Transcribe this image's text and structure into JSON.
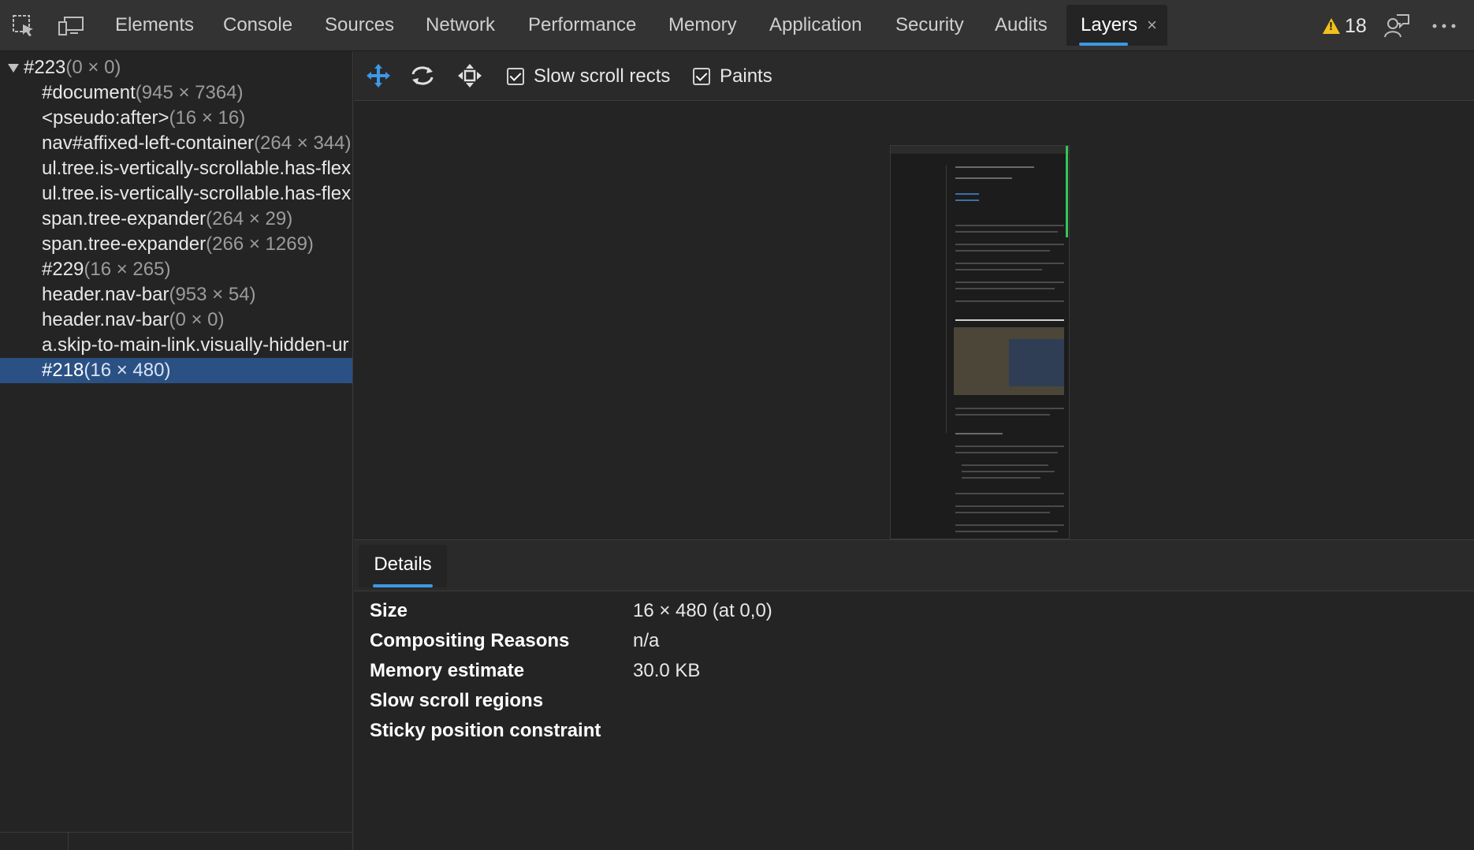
{
  "colors": {
    "accent": "#3c99e6",
    "selected_row": "#2b5184",
    "warning": "#f1c21b"
  },
  "topbar": {
    "tabs": [
      {
        "label": "Elements"
      },
      {
        "label": "Console"
      },
      {
        "label": "Sources"
      },
      {
        "label": "Network"
      },
      {
        "label": "Performance"
      },
      {
        "label": "Memory"
      },
      {
        "label": "Application"
      },
      {
        "label": "Security"
      },
      {
        "label": "Audits"
      },
      {
        "label": "Layers",
        "active": true
      }
    ],
    "close_glyph": "×",
    "warning_count": "18",
    "icons": [
      "inspect-element-icon",
      "device-toolbar-icon",
      "warning-icon",
      "feedback-icon",
      "more-menu-icon"
    ]
  },
  "tree": {
    "root": {
      "name": "#223",
      "size": "(0 × 0)"
    },
    "items": [
      {
        "name": "#document",
        "size": "(945 × 7364)"
      },
      {
        "name": "<pseudo:after>",
        "size": "(16 × 16)"
      },
      {
        "name": "nav#affixed-left-container",
        "size": "(264 × 344)"
      },
      {
        "name": "ul.tree.is-vertically-scrollable.has-flex",
        "size": ""
      },
      {
        "name": "ul.tree.is-vertically-scrollable.has-flex",
        "size": ""
      },
      {
        "name": "span.tree-expander",
        "size": "(264 × 29)"
      },
      {
        "name": "span.tree-expander",
        "size": "(266 × 1269)"
      },
      {
        "name": "#229",
        "size": "(16 × 265)"
      },
      {
        "name": "header.nav-bar",
        "size": "(953 × 54)"
      },
      {
        "name": "header.nav-bar",
        "size": "(0 × 0)"
      },
      {
        "name": "a.skip-to-main-link.visually-hidden-ur",
        "size": ""
      },
      {
        "name": "#218",
        "size": "(16 × 480)",
        "selected": true
      }
    ]
  },
  "toolbar": {
    "icons": [
      "pan-mode-icon",
      "rotate-mode-icon",
      "reset-transform-icon"
    ],
    "slow_scroll_rects": {
      "label": "Slow scroll rects",
      "checked": true
    },
    "paints": {
      "label": "Paints",
      "checked": true
    }
  },
  "details": {
    "tab_label": "Details",
    "rows": [
      {
        "key": "Size",
        "value": "16 × 480 (at 0,0)"
      },
      {
        "key": "Compositing Reasons",
        "value": "n/a"
      },
      {
        "key": "Memory estimate",
        "value": "30.0 KB"
      },
      {
        "key": "Slow scroll regions",
        "value": ""
      },
      {
        "key": "Sticky position constraint",
        "value": ""
      }
    ]
  }
}
